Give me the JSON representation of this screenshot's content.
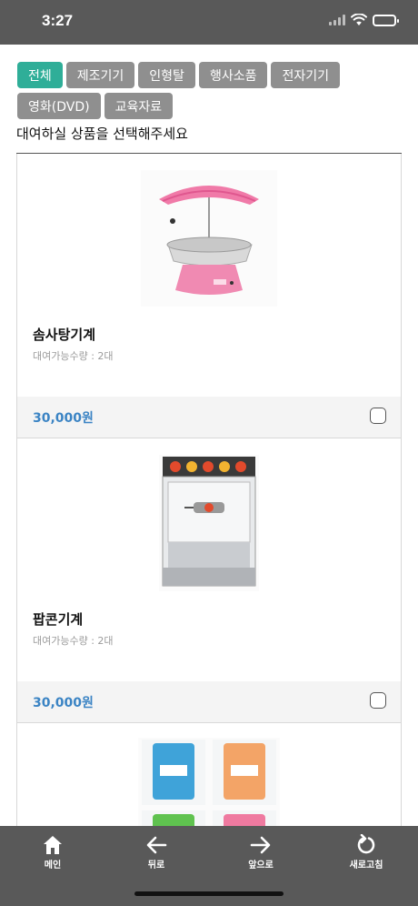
{
  "status_bar": {
    "time": "3:27"
  },
  "categories": [
    {
      "label": "전체",
      "active": true
    },
    {
      "label": "제조기기",
      "active": false
    },
    {
      "label": "인형탈",
      "active": false
    },
    {
      "label": "행사소품",
      "active": false
    },
    {
      "label": "전자기기",
      "active": false
    },
    {
      "label": "영화(DVD)",
      "active": false
    },
    {
      "label": "교육자료",
      "active": false
    }
  ],
  "instruction": "대여하실 상품을 선택해주세요",
  "products": [
    {
      "name": "솜사탕기계",
      "qty": "대여가능수량 : 2대",
      "price": "30,000원",
      "image": "cotton-candy-machine"
    },
    {
      "name": "팝콘기계",
      "qty": "대여가능수량 : 2대",
      "price": "30,000원",
      "image": "popcorn-machine"
    },
    {
      "image": "cotton-candy-sugar-packs"
    }
  ],
  "bottom_nav": [
    {
      "label": "메인",
      "icon": "home-icon"
    },
    {
      "label": "뒤로",
      "icon": "arrow-left-icon"
    },
    {
      "label": "앞으로",
      "icon": "arrow-right-icon"
    },
    {
      "label": "새로고침",
      "icon": "refresh-icon"
    }
  ],
  "colors": {
    "accent": "#2fae98",
    "tab": "#8f8f8f",
    "price": "#3b84c4",
    "bars": "#595959"
  }
}
